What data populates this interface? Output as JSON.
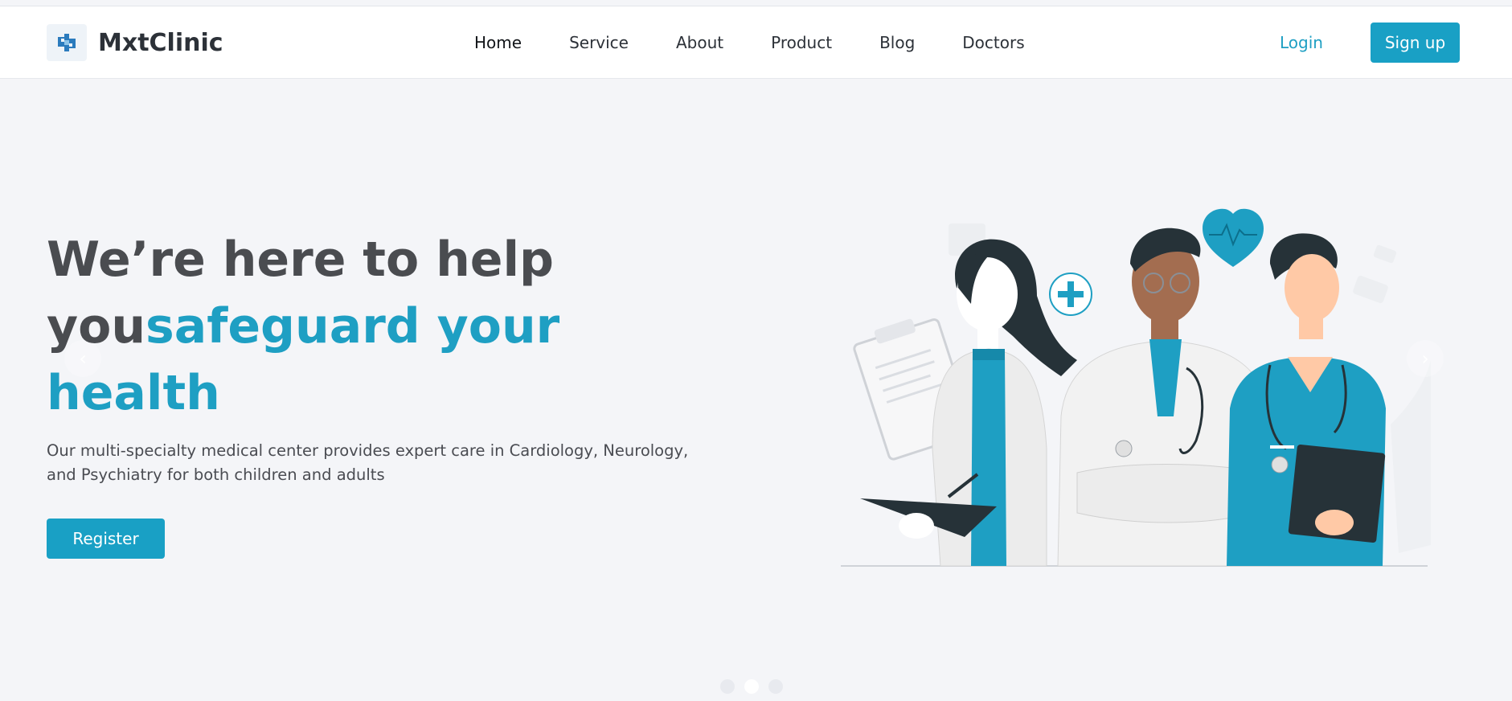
{
  "header": {
    "brand": "MxtClinic",
    "nav": [
      {
        "label": "Home",
        "active": true
      },
      {
        "label": "Service"
      },
      {
        "label": "About"
      },
      {
        "label": "Product"
      },
      {
        "label": "Blog"
      },
      {
        "label": "Doctors"
      }
    ],
    "login_label": "Login",
    "signup_label": "Sign up"
  },
  "hero": {
    "title_line1": "We’re here to help",
    "title_plain": "you",
    "title_accent_1": "safeguard your",
    "title_accent_2": "health",
    "description": "Our multi-specialty medical center provides expert care in Cardiology, Neurology, and Psychiatry for both children and adults",
    "register_label": "Register"
  },
  "carousel": {
    "slides": 3,
    "active_slide": 2,
    "prev_icon": "chevron-left-icon",
    "next_icon": "chevron-right-icon"
  },
  "colors": {
    "accent": "#1e9fc3",
    "button": "#19a0c5",
    "heading": "#4a4c50",
    "background": "#f4f5f8"
  }
}
